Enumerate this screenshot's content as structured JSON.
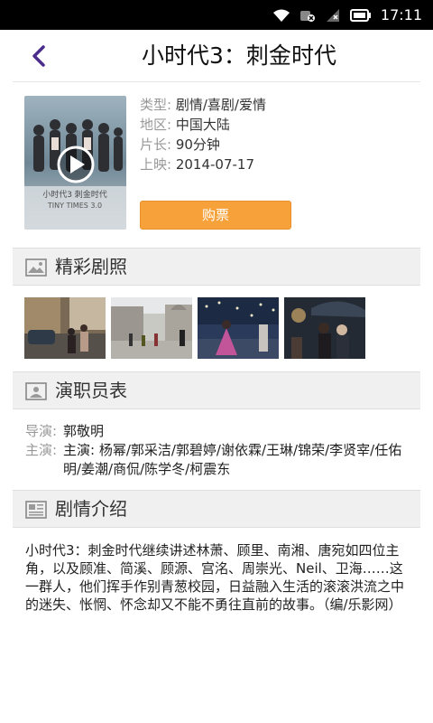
{
  "status_bar": {
    "time": "17:11",
    "icons": [
      "wifi-icon",
      "sync-icon",
      "signal-icon",
      "battery-icon"
    ]
  },
  "header": {
    "title": "小时代3：刺金时代",
    "back_icon": "chevron-left-icon"
  },
  "movie": {
    "info": [
      {
        "label": "类型:",
        "value": "剧情/喜剧/爱情"
      },
      {
        "label": "地区:",
        "value": "中国大陆"
      },
      {
        "label": "片长:",
        "value": "90分钟"
      },
      {
        "label": "上映:",
        "value": "2014-07-17"
      }
    ],
    "buy_label": "购票",
    "poster_title": "小时代3 刺金时代",
    "poster_subtitle": "TINY TIMES 3.0"
  },
  "sections": {
    "stills_title": "精彩剧照",
    "cast_title": "演职员表",
    "plot_title": "剧情介绍"
  },
  "cast": {
    "director_label": "导演:",
    "director": "郭敬明",
    "stars_label": "主演:",
    "stars": "主演: 杨幂/郭采洁/郭碧婷/谢依霖/王琳/锦荣/李贤宰/任佑明/姜潮/商侃/陈学冬/柯震东"
  },
  "plot": {
    "text": "小时代3：刺金时代继续讲述林萧、顾里、南湘、唐宛如四位主角，以及顾准、简溪、顾源、宫洺、周崇光、Neil、卫海……这一群人，他们挥手作别青葱校园，日益融入生活的滚滚洪流之中的迷失、怅惘、怀念却又不能不勇往直前的故事。（编/乐影网）"
  },
  "colors": {
    "accent": "#f6a13a",
    "back_arrow": "#4a2c8a",
    "section_bg": "#f0f0f0"
  }
}
